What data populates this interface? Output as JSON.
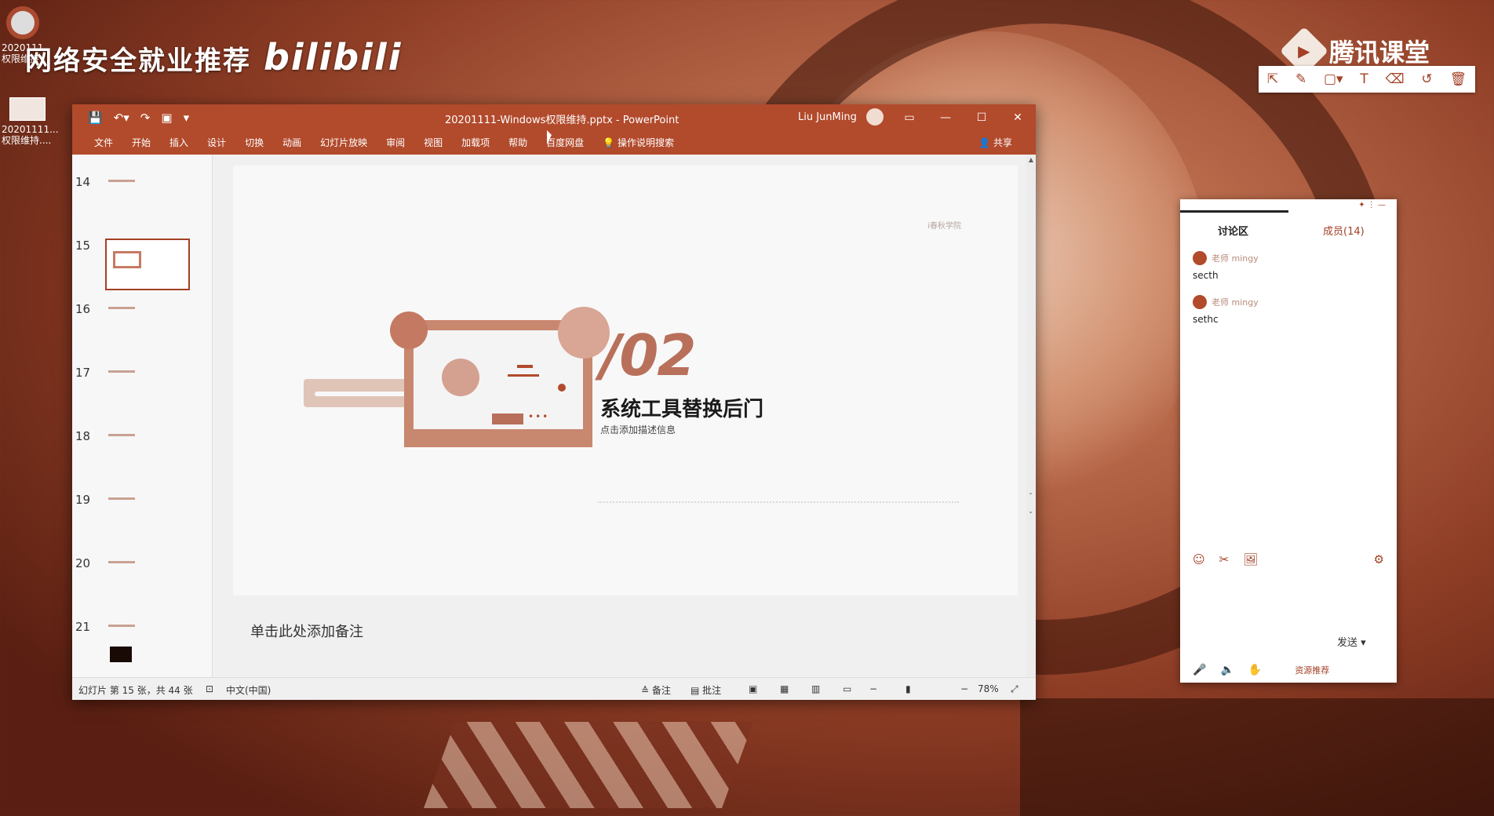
{
  "desktop": {
    "watermark_text": "网络安全就业推荐",
    "watermark_logo": "bilibili",
    "icon1_label": "2020111",
    "icon1_label2": "权限维持",
    "icon2_label": "20201111...",
    "icon2_label2": "权限维持...."
  },
  "tencent": {
    "brand": "腾讯课堂",
    "play_glyph": "▶",
    "tools": [
      "⇱",
      "✎",
      "▢▾",
      "T",
      "⌫",
      "↺",
      "🗑"
    ]
  },
  "ppt": {
    "title": "20201111-Windows权限维持.pptx  -  PowerPoint",
    "user": "Liu JunMing",
    "qat": [
      "💾",
      "↶▾",
      "↷",
      "▣",
      "▾"
    ],
    "window_controls": [
      "▭",
      "—",
      "☐",
      "✕"
    ],
    "ribbon_tabs": [
      "文件",
      "开始",
      "插入",
      "设计",
      "切换",
      "动画",
      "幻灯片放映",
      "审阅",
      "视图",
      "加载项",
      "帮助",
      "百度网盘",
      "💡  操作说明搜索"
    ],
    "share": "共享",
    "thumbnails": [
      "14",
      "15",
      "16",
      "17",
      "18",
      "19",
      "20",
      "21"
    ],
    "selected_slide": "15",
    "slide": {
      "logo_text": "i春秋学院",
      "number": "/02",
      "title": "系统工具替换后门",
      "subtitle": "点击添加描述信息"
    },
    "notes_placeholder": "单击此处添加备注",
    "status": {
      "slide_info": "幻灯片 第 15 张，共 44 张",
      "language": "中文(中国)",
      "notes": "≙ 备注",
      "comments": "▤ 批注",
      "zoom": "78%"
    }
  },
  "discussion": {
    "tab_active": "讨论区",
    "tab_members": "成员(14)",
    "messages": [
      {
        "name": "老师 mingy",
        "text": "secth"
      },
      {
        "name": "老师 mingy",
        "text": "sethc"
      }
    ],
    "tools": [
      "☺",
      "✂",
      "🖼",
      "⚙"
    ],
    "send": "发送",
    "bottom": [
      "🎤",
      "🔈",
      "✋"
    ],
    "bottom_label": "资源推荐"
  }
}
